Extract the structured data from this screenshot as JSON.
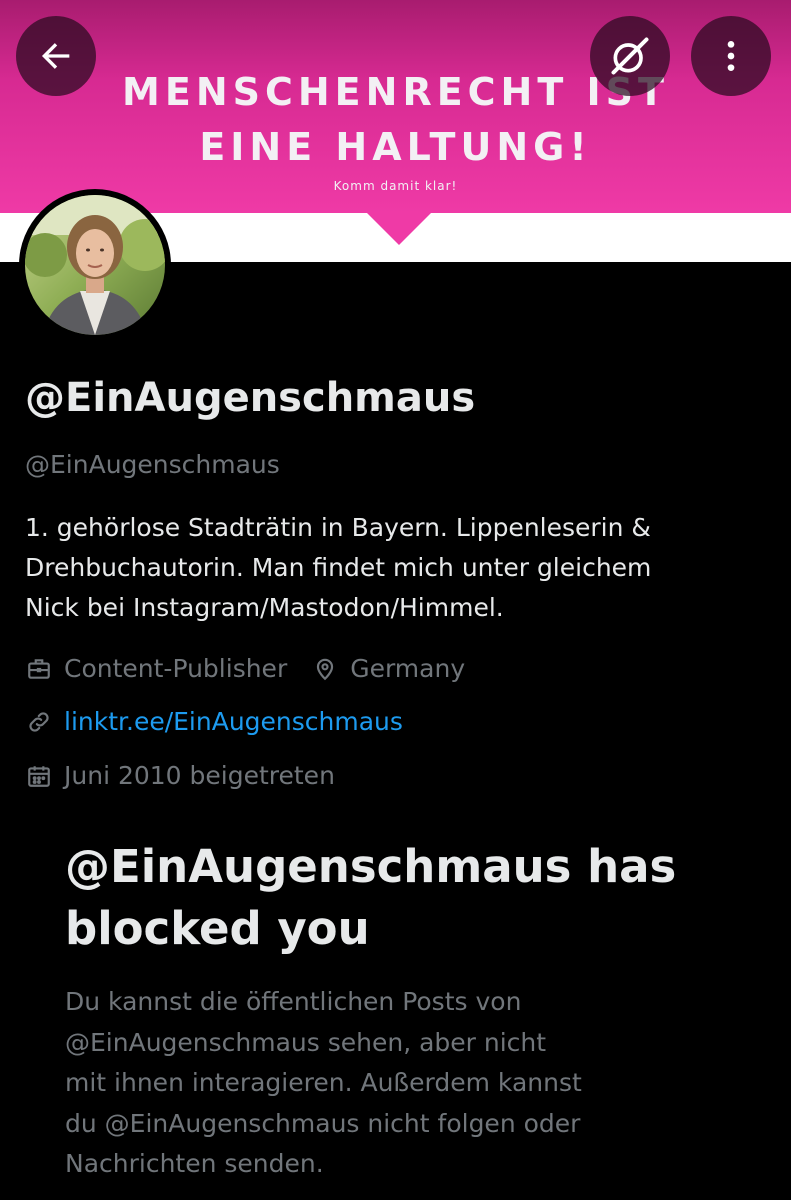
{
  "header": {
    "banner": {
      "line1": "MENSCHENRECHT IST",
      "line2": "EINE HALTUNG!",
      "line3": "Komm damit klar!"
    },
    "back_icon": "arrow-left-icon",
    "grok_icon": "grok-icon",
    "more_icon": "more-vertical-icon"
  },
  "profile": {
    "display_name": "@EinAugenschmaus",
    "handle": "@EinAugenschmaus",
    "bio_lines": [
      "1. gehörlose Stadträtin in Bayern. Lippenleserin &",
      "Drehbuchautorin. Man findet mich unter gleichem",
      "Nick bei Instagram/Mastodon/Himmel."
    ],
    "category": "Content-Publisher",
    "location": "Germany",
    "link": "linktr.ee/EinAugenschmaus",
    "joined": "Juni 2010 beigetreten"
  },
  "blocked": {
    "title_lines": [
      "@EinAugenschmaus has",
      "blocked you"
    ],
    "description_lines": [
      "Du kannst die öffentlichen Posts von",
      "@EinAugenschmaus sehen, aber nicht",
      "mit ihnen interagieren. Außerdem kannst",
      "du @EinAugenschmaus nicht folgen oder",
      "Nachrichten senden."
    ]
  },
  "colors": {
    "background": "#000000",
    "banner_pink": "#ef3aa6",
    "text_primary": "#e7e9ea",
    "text_secondary": "#71767b",
    "link": "#1d9bf0"
  }
}
